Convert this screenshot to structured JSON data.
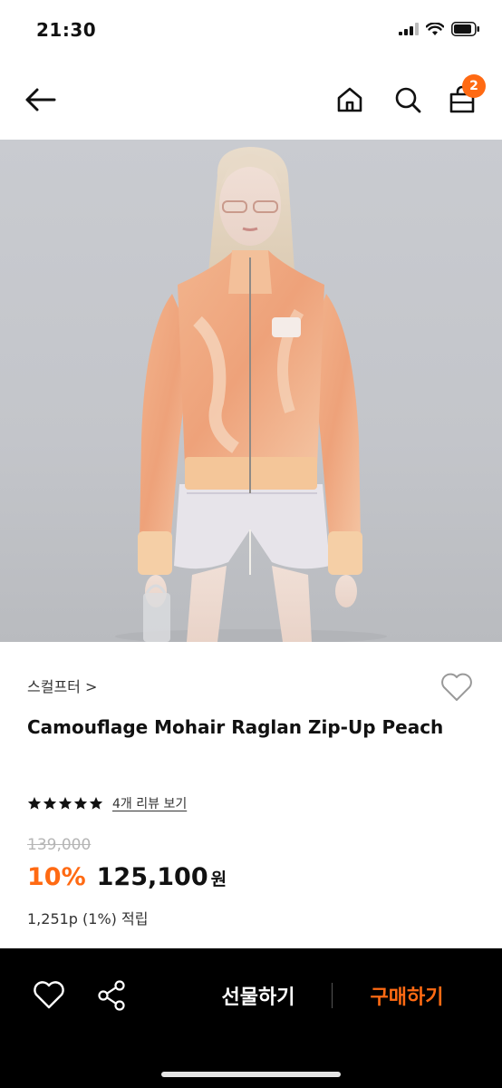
{
  "status": {
    "time": "21:30"
  },
  "nav": {
    "cart_count": "2"
  },
  "product": {
    "brand": "스컬프터 >",
    "title": "Camouflage Mohair Raglan Zip-Up Peach",
    "rating_stars": 5,
    "review_link": "4개 리뷰 보기",
    "original_price": "139,000",
    "discount": "10%",
    "price": "125,100",
    "currency": "원",
    "points": "1,251p (1%) 적립"
  },
  "bottom_bar": {
    "gift_label": "선물하기",
    "buy_label": "구매하기"
  },
  "colors": {
    "accent": "#ff6a13",
    "bottom_bar_bg": "#000000"
  },
  "icons": [
    "back-arrow-icon",
    "home-icon",
    "search-icon",
    "cart-icon",
    "heart-icon",
    "share-icon",
    "star-icon"
  ]
}
